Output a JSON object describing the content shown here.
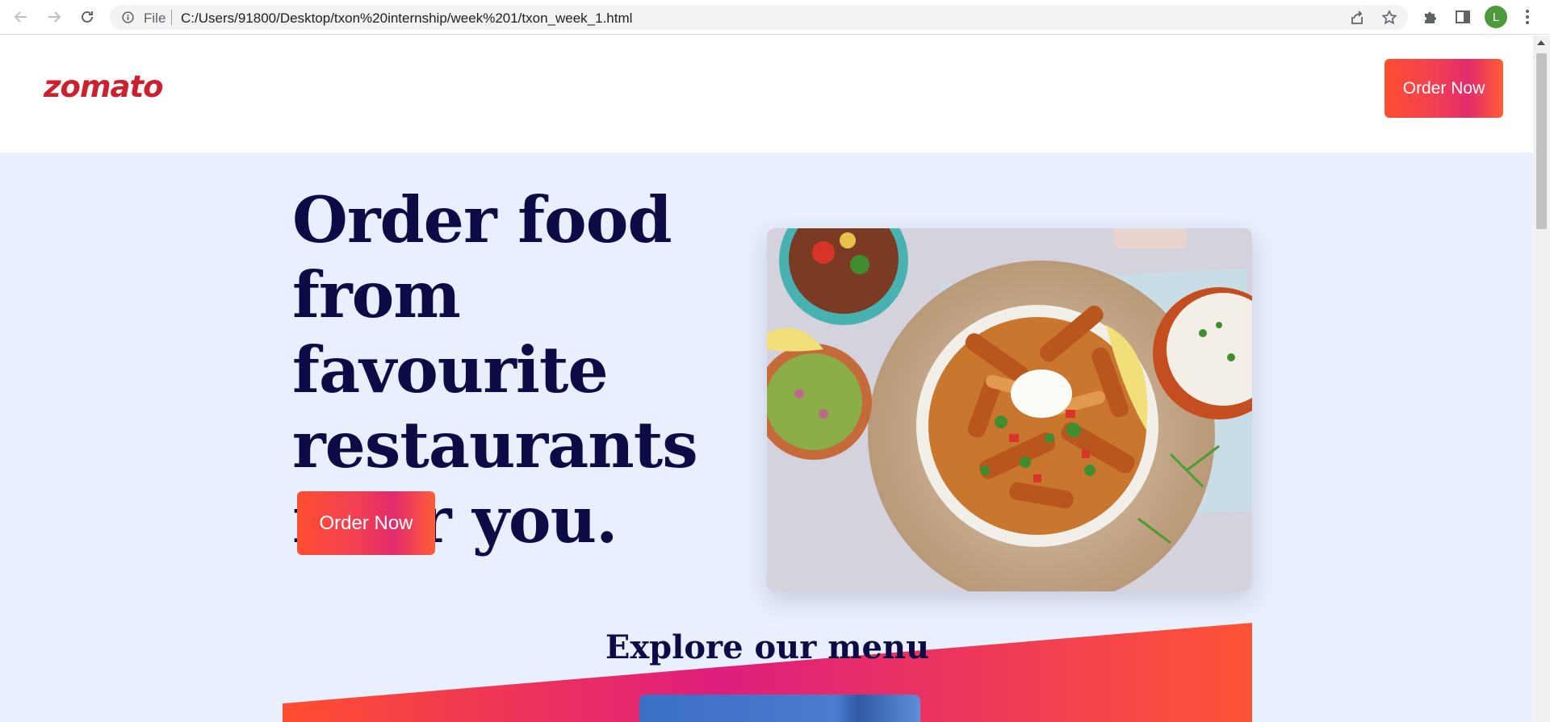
{
  "browser": {
    "protocol_label": "File",
    "url": "C:/Users/91800/Desktop/txon%20internship/week%201/txon_week_1.html",
    "profile_initial": "L"
  },
  "site": {
    "logo": "zomato",
    "header_button": "Order Now",
    "hero": {
      "title": "Order food from favourite restaurants near you.",
      "button": "Order Now"
    },
    "explore": {
      "title": "Explore our menu"
    }
  },
  "colors": {
    "brand_red": "#cb202d",
    "hero_bg": "#e9f0fd",
    "title_navy": "#0b0b46",
    "gradient_start": "#ff4e30",
    "gradient_mid": "#e22b6b"
  },
  "icons": {
    "back": "arrow-left-icon",
    "forward": "arrow-right-icon",
    "reload": "reload-icon",
    "info": "info-icon",
    "share": "share-icon",
    "bookmark": "star-icon",
    "extensions": "puzzle-icon",
    "side_panel": "side-panel-icon",
    "menu": "kebab-menu-icon"
  }
}
